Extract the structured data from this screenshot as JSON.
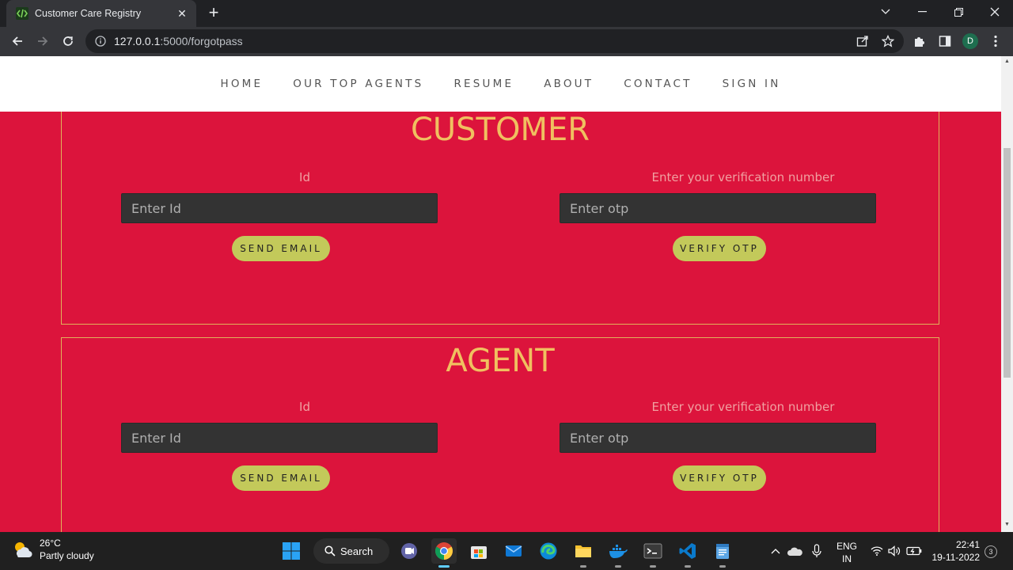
{
  "browser": {
    "tab_title": "Customer Care Registry",
    "url_host": "127.0.0.1",
    "url_path": ":5000/forgotpass",
    "profile_initial": "D"
  },
  "nav": {
    "items": [
      "HOME",
      "OUR TOP AGENTS",
      "RESUME",
      "ABOUT",
      "CONTACT",
      "SIGN IN"
    ]
  },
  "customer": {
    "title": "CUSTOMER",
    "id_label": "Id",
    "id_placeholder": "Enter Id",
    "otp_label": "Enter your verification number",
    "otp_placeholder": "Enter otp",
    "send_email": "SEND EMAIL",
    "verify_otp": "VERIFY OTP"
  },
  "agent": {
    "title": "AGENT",
    "id_label": "Id",
    "id_placeholder": "Enter Id",
    "otp_label": "Enter your verification number",
    "otp_placeholder": "Enter otp",
    "send_email": "SEND EMAIL",
    "verify_otp": "VERIFY OTP"
  },
  "taskbar": {
    "temperature": "26°C",
    "weather": "Partly cloudy",
    "search_label": "Search",
    "lang_top": "ENG",
    "lang_bottom": "IN",
    "time": "22:41",
    "date": "19-11-2022",
    "notification_count": "3"
  },
  "colors": {
    "page_bg": "#dc143c",
    "title_gold": "#f0c060",
    "button_green": "#c3c95a",
    "input_bg": "#333333"
  }
}
